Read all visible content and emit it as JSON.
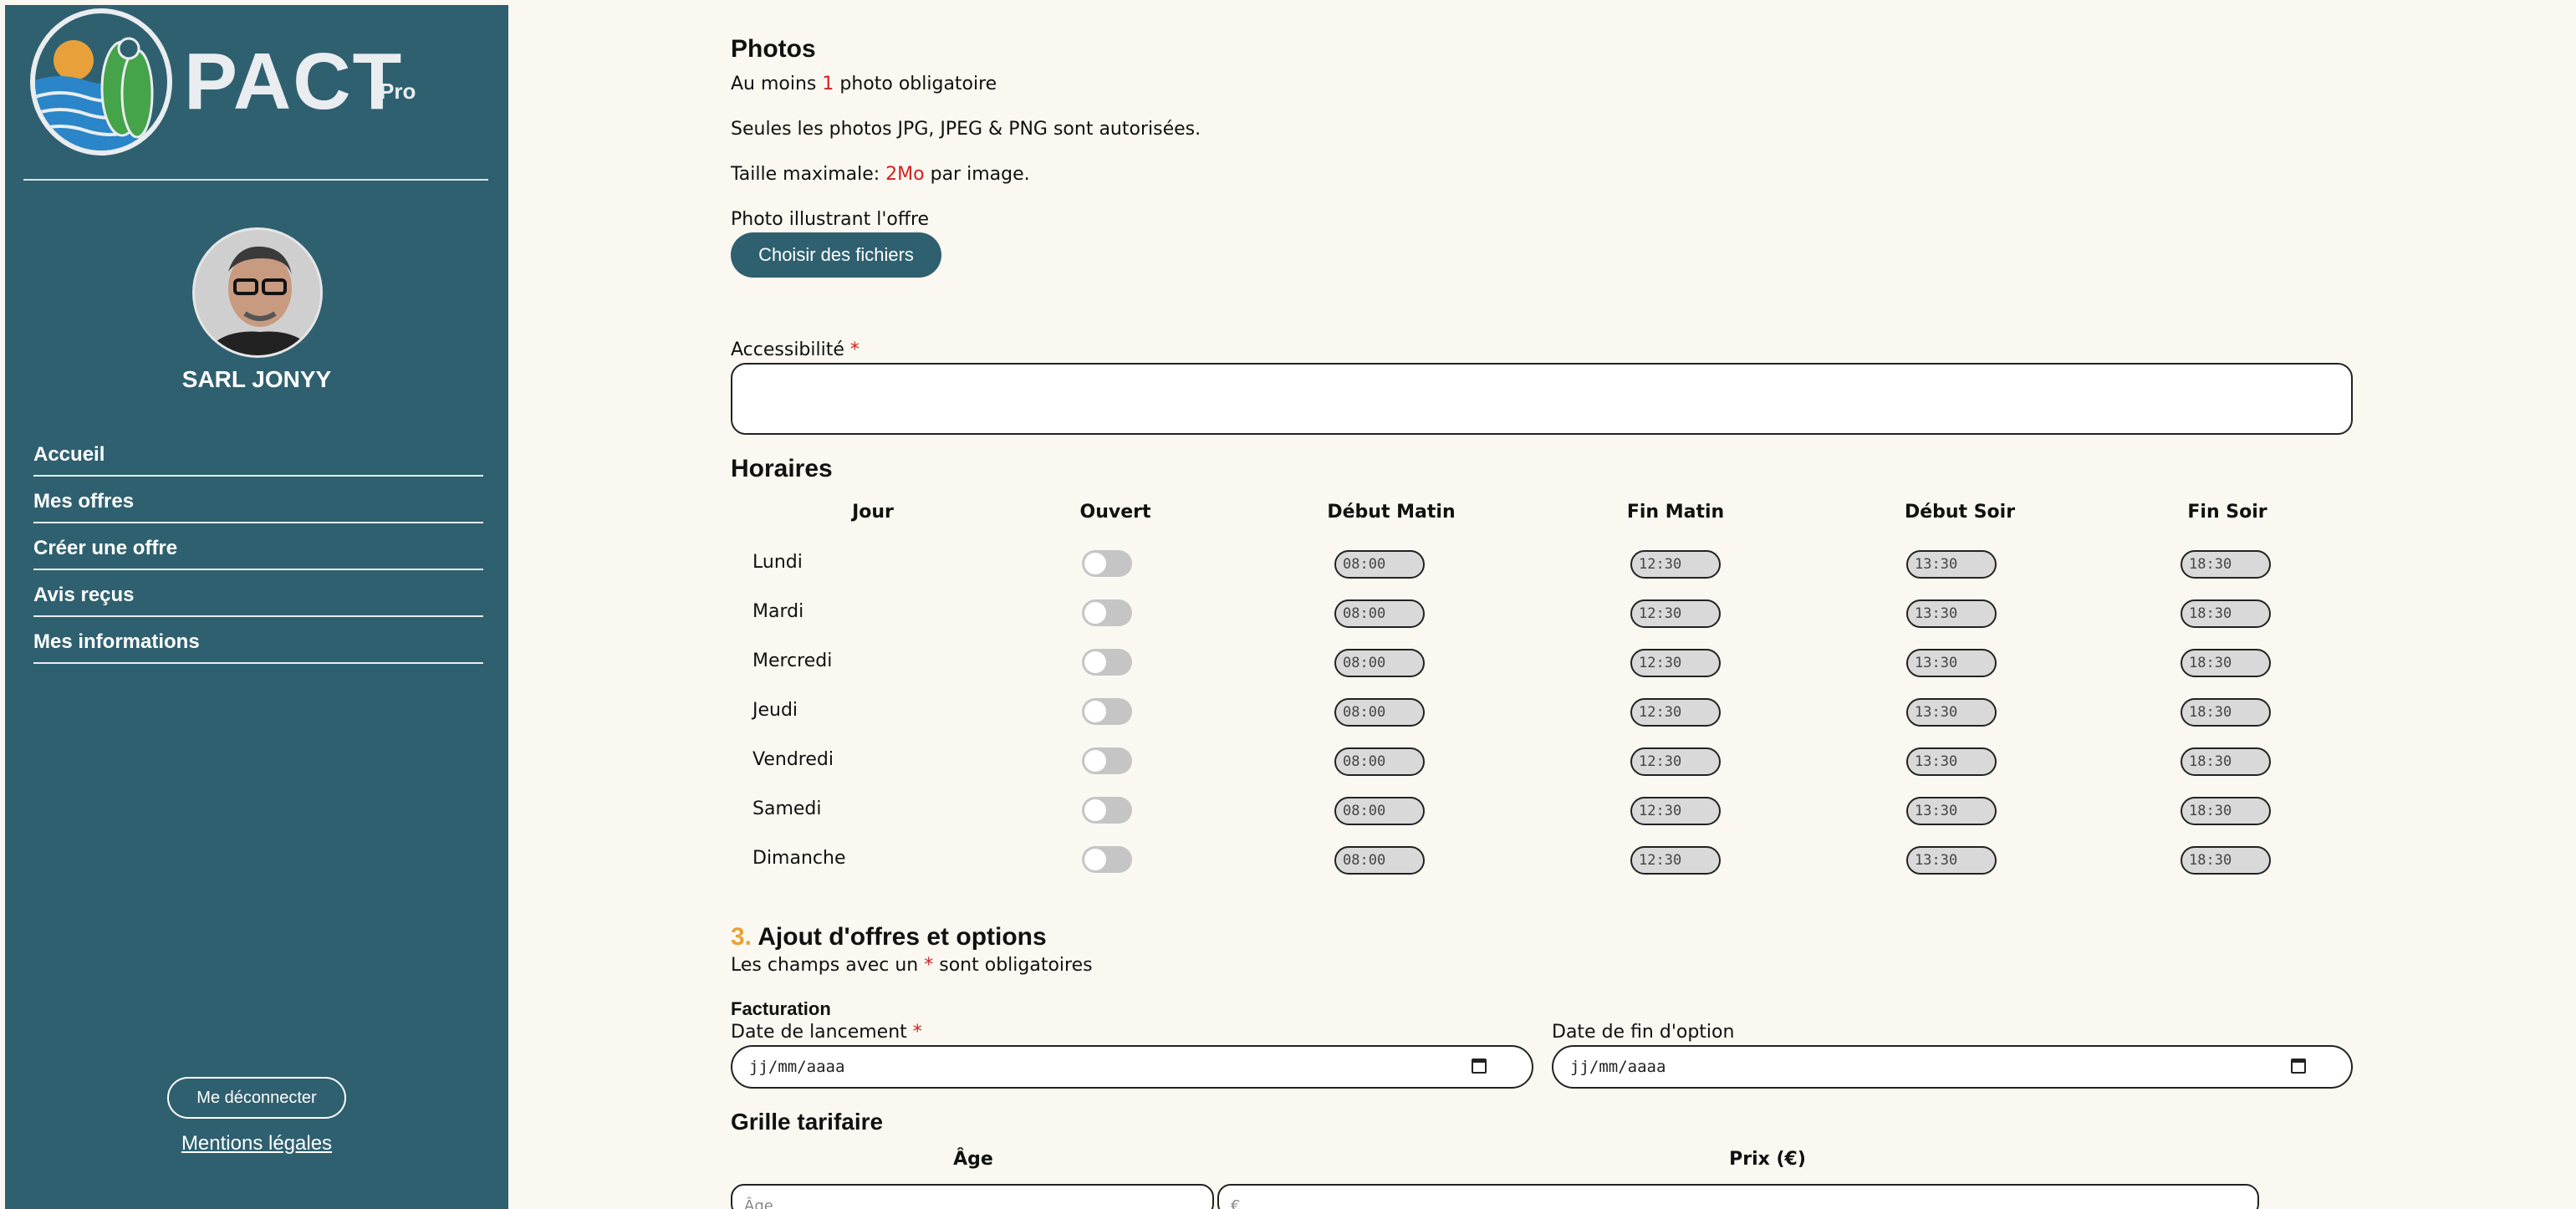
{
  "sidebar": {
    "logo_text": "PACT",
    "logo_suffix": "Pro",
    "company_name": "SARL JONYY",
    "nav": [
      {
        "label": "Accueil"
      },
      {
        "label": "Mes offres"
      },
      {
        "label": "Créer une offre"
      },
      {
        "label": "Avis reçus"
      },
      {
        "label": "Mes informations"
      }
    ],
    "logout_label": "Me déconnecter",
    "legal_label": "Mentions légales"
  },
  "photos": {
    "title": "Photos",
    "min_prefix": "Au moins ",
    "min_count": "1",
    "min_suffix": " photo obligatoire",
    "formats": "Seules les photos JPG, JPEG & PNG sont autorisées.",
    "size_prefix": "Taille maximale: ",
    "size_value": "2Mo",
    "size_suffix": " par image.",
    "field_label": "Photo illustrant l'offre",
    "button_label": "Choisir des fichiers"
  },
  "accessibility": {
    "label": "Accessibilité",
    "required_mark": "*"
  },
  "hours": {
    "title": "Horaires",
    "headers": [
      "Jour",
      "Ouvert",
      "Début Matin",
      "Fin Matin",
      "Début Soir",
      "Fin Soir"
    ],
    "rows": [
      {
        "day": "Lundi",
        "open": false,
        "am_start": "08:00",
        "am_end": "12:30",
        "pm_start": "13:30",
        "pm_end": "18:30"
      },
      {
        "day": "Mardi",
        "open": false,
        "am_start": "08:00",
        "am_end": "12:30",
        "pm_start": "13:30",
        "pm_end": "18:30"
      },
      {
        "day": "Mercredi",
        "open": false,
        "am_start": "08:00",
        "am_end": "12:30",
        "pm_start": "13:30",
        "pm_end": "18:30"
      },
      {
        "day": "Jeudi",
        "open": false,
        "am_start": "08:00",
        "am_end": "12:30",
        "pm_start": "13:30",
        "pm_end": "18:30"
      },
      {
        "day": "Vendredi",
        "open": false,
        "am_start": "08:00",
        "am_end": "12:30",
        "pm_start": "13:30",
        "pm_end": "18:30"
      },
      {
        "day": "Samedi",
        "open": false,
        "am_start": "08:00",
        "am_end": "12:30",
        "pm_start": "13:30",
        "pm_end": "18:30"
      },
      {
        "day": "Dimanche",
        "open": false,
        "am_start": "08:00",
        "am_end": "12:30",
        "pm_start": "13:30",
        "pm_end": "18:30"
      }
    ]
  },
  "section3": {
    "number": "3.",
    "title": " Ajout d'offres et options",
    "note_prefix": "Les champs avec un ",
    "note_mark": "*",
    "note_suffix": " sont obligatoires",
    "billing_title": "Facturation",
    "launch_label": "Date de lancement",
    "launch_mark": "*",
    "launch_placeholder": "jj/mm/aaaa",
    "end_label": "Date de fin d'option",
    "end_placeholder": "jj/mm/aaaa"
  },
  "pricing": {
    "title": "Grille tarifaire",
    "age_header": "Âge",
    "price_header": "Prix (€)",
    "age_placeholder": "Âge",
    "price_placeholder": "€"
  },
  "colors": {
    "sidebar_bg": "#2f6070",
    "page_bg": "#faf8f0",
    "accent_red": "#d42020",
    "accent_orange": "#e8a13a"
  }
}
